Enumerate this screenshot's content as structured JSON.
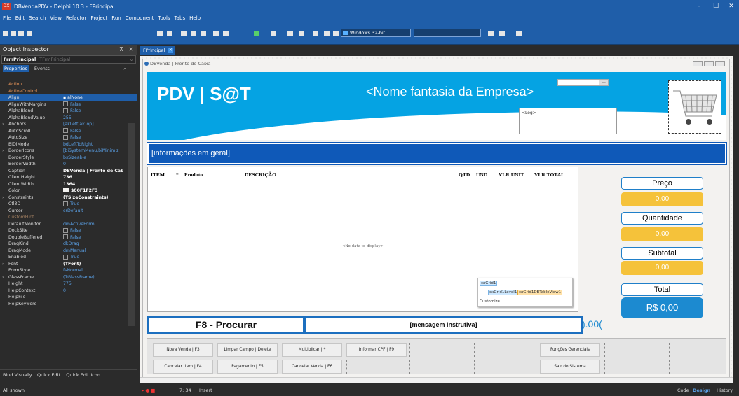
{
  "window": {
    "title": "DBVendaPDV - Delphi 10.3 - FPrincipal",
    "app_icon": "DX",
    "minimize": "–",
    "maximize": "☐",
    "close": "✕"
  },
  "menu": [
    "File",
    "Edit",
    "Search",
    "View",
    "Refactor",
    "Project",
    "Run",
    "Component",
    "Tools",
    "Tabs",
    "Help"
  ],
  "toolbar": {
    "platform": "Windows 32-bit"
  },
  "object_inspector": {
    "title": "Object Inspector",
    "pin": "⊼",
    "close": "✕",
    "component": "FrmPrincipal",
    "component_class": "TFrmPrincipal",
    "tabs": [
      "Properties",
      "Events"
    ],
    "rows": [
      {
        "name": "Action",
        "value": ""
      },
      {
        "name": "ActiveControl",
        "value": ""
      },
      {
        "name": "Align",
        "value": "alNone"
      },
      {
        "name": "AlignWithMargins",
        "value": "False"
      },
      {
        "name": "AlphaBlend",
        "value": "False"
      },
      {
        "name": "AlphaBlendValue",
        "value": "255"
      },
      {
        "name": "Anchors",
        "value": "[akLeft,akTop]"
      },
      {
        "name": "AutoScroll",
        "value": "False"
      },
      {
        "name": "AutoSize",
        "value": "False"
      },
      {
        "name": "BiDiMode",
        "value": "bdLeftToRight"
      },
      {
        "name": "BorderIcons",
        "value": "[biSystemMenu,biMinimiz"
      },
      {
        "name": "BorderStyle",
        "value": "bsSizeable"
      },
      {
        "name": "BorderWidth",
        "value": "0"
      },
      {
        "name": "Caption",
        "value": "DBVenda | Frente de Cab"
      },
      {
        "name": "ClientHeight",
        "value": "736"
      },
      {
        "name": "ClientWidth",
        "value": "1364"
      },
      {
        "name": "Color",
        "value": "$00F1F2F3"
      },
      {
        "name": "Constraints",
        "value": "(TSizeConstraints)"
      },
      {
        "name": "Ctl3D",
        "value": "True"
      },
      {
        "name": "Cursor",
        "value": "crDefault"
      },
      {
        "name": "CustomHint",
        "value": ""
      },
      {
        "name": "DefaultMonitor",
        "value": "dmActiveForm"
      },
      {
        "name": "DockSite",
        "value": "False"
      },
      {
        "name": "DoubleBuffered",
        "value": "False"
      },
      {
        "name": "DragKind",
        "value": "dkDrag"
      },
      {
        "name": "DragMode",
        "value": "dmManual"
      },
      {
        "name": "Enabled",
        "value": "True"
      },
      {
        "name": "Font",
        "value": "(TFont)"
      },
      {
        "name": "FormStyle",
        "value": "fsNormal"
      },
      {
        "name": "GlassFrame",
        "value": "(TGlassFrame)"
      },
      {
        "name": "Height",
        "value": "775"
      },
      {
        "name": "HelpContext",
        "value": "0"
      },
      {
        "name": "HelpFile",
        "value": ""
      },
      {
        "name": "HelpKeyword",
        "value": ""
      }
    ],
    "footer": "Bind Visually...  Quick Edit...  Quick Edit Icon...",
    "all_shown": "All shown"
  },
  "editor_tab": "FPrincipal",
  "form": {
    "caption": "DBVenda | Frente de Caixa",
    "brand": "PDV | S@T",
    "fantasy_name": "<Nome fantasia da Empresa>",
    "log": "<Log>",
    "ellipsis": "...",
    "info_bar": "[informações em geral]",
    "grid_columns": [
      "ITEM",
      "*",
      "Produto",
      "DESCRIÇÃO",
      "QTD",
      "UND",
      "VLR UNIT",
      "VLR TOTAL"
    ],
    "no_data": "<No data to display>",
    "cx_popup": {
      "grid": "cxGrid1",
      "level": "cxGrid1Level1",
      "view": "cxGrid1DBTableView1",
      "customize": "Customize..."
    },
    "price_label": "Preço",
    "price_value": "0,00",
    "qty_label": "Quantidade",
    "qty_value": "0,00",
    "subtotal_label": "Subtotal",
    "subtotal_value": "0,00",
    "total_label": "Total",
    "total_value": "R$ 0,00",
    "search_label": "F8 - Procurar",
    "instruction": "[mensagem instrutiva]",
    "qty_readout": ").00(",
    "buttons_row1": [
      "Nova Venda | F3",
      "Limpar Campo | Delete",
      "Multiplicar | *",
      "Informar CPF | F9"
    ],
    "buttons_row2": [
      "Cancelar Item | F4",
      "Pagamento | F5",
      "Cancelar Venda | F6"
    ],
    "manager_button": "Funções Gerenciais",
    "exit_button": "Sair do Sistema"
  },
  "status": {
    "position": "7: 34",
    "mode": "Insert",
    "tabs": [
      "Code",
      "Design",
      "History"
    ]
  },
  "colors": {
    "ide_blue": "#1f5ea9",
    "header_blue": "#05a3e3",
    "info_blue": "#0f59b8",
    "value_yellow": "#f5c23a",
    "total_blue": "#1c8ad0"
  }
}
